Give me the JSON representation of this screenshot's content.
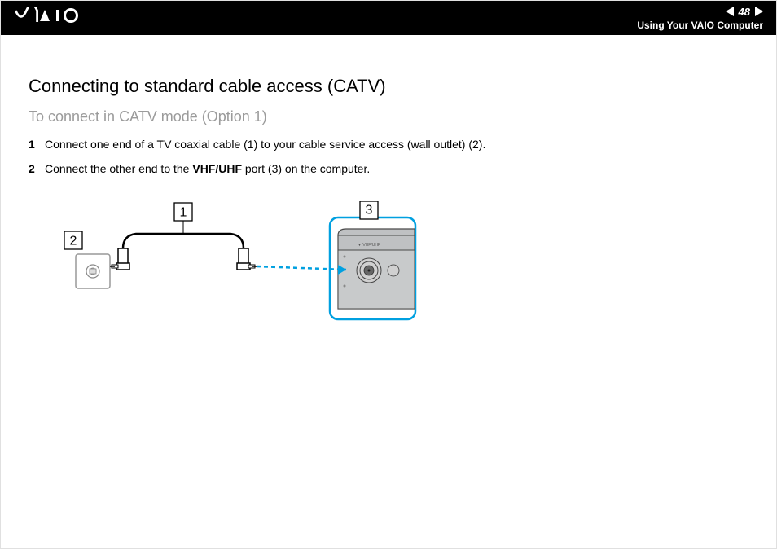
{
  "header": {
    "logo_text": "VAIO",
    "page_number": "48",
    "breadcrumb": "Using Your VAIO Computer"
  },
  "content": {
    "title": "Connecting to standard cable access (CATV)",
    "subtitle": "To connect in CATV mode (Option 1)",
    "steps": [
      {
        "num": "1",
        "text_before": "Connect one end of a TV coaxial cable (1) to your cable service access (wall outlet) (2).",
        "bold": "",
        "text_after": ""
      },
      {
        "num": "2",
        "text_before": "Connect the other end to the ",
        "bold": "VHF/UHF",
        "text_after": " port (3) on the computer."
      }
    ],
    "diagram": {
      "callouts": {
        "cable": "1",
        "wall": "2",
        "port": "3"
      }
    }
  }
}
